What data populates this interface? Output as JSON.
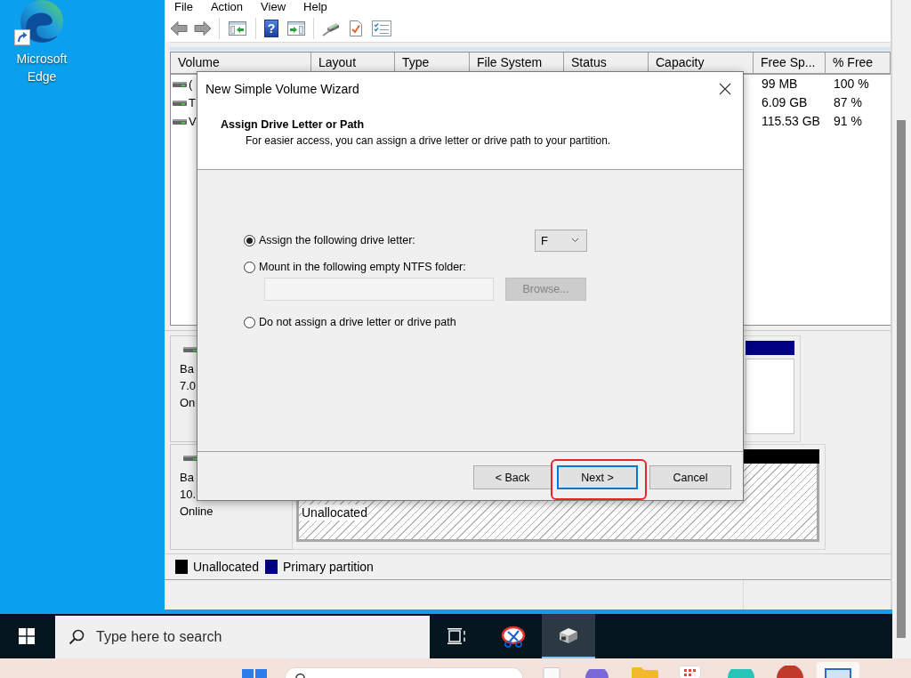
{
  "desktop": {
    "shortcuts": [
      {
        "label": "Microsoft Edge"
      }
    ]
  },
  "disk_management": {
    "menu": [
      "File",
      "Action",
      "View",
      "Help"
    ],
    "toolbar": {
      "help_glyph": "?"
    },
    "volume_list": {
      "columns": [
        "Volume",
        "Layout",
        "Type",
        "File System",
        "Status",
        "Capacity",
        "Free Sp...",
        "% Free"
      ],
      "rows": [
        {
          "volume": "(",
          "free_space": "99 MB",
          "percent_free": "100 %"
        },
        {
          "volume": "T",
          "free_space": "6.09 GB",
          "percent_free": "87 %"
        },
        {
          "volume": "V",
          "free_space": "115.53 GB",
          "percent_free": "91 %"
        }
      ]
    },
    "disks": [
      {
        "info": [
          "Ba",
          "7.0",
          "On"
        ],
        "partitions": [
          {
            "kind": "primary"
          }
        ]
      },
      {
        "info": [
          "Ba",
          "10.",
          "Online"
        ],
        "partitions": [
          {
            "kind": "unallocated",
            "label": "Unallocated"
          }
        ]
      }
    ],
    "legend": [
      {
        "label": "Unallocated",
        "color": "#000000"
      },
      {
        "label": "Primary partition",
        "color": "#000080"
      }
    ]
  },
  "wizard": {
    "title": "New Simple Volume Wizard",
    "heading": "Assign Drive Letter or Path",
    "description": "For easier access, you can assign a drive letter or drive path to your partition.",
    "options": [
      {
        "kind": "letter",
        "label": "Assign the following drive letter:",
        "selected": true,
        "drive_letter": {
          "value": "F"
        }
      },
      {
        "kind": "folder",
        "label": "Mount in the following empty NTFS folder:",
        "selected": false,
        "path_field": {
          "disabled": true
        },
        "browse_button": {
          "label": "Browse...",
          "disabled": true
        }
      },
      {
        "kind": "none",
        "label": "Do not assign a drive letter or drive path",
        "selected": false
      }
    ],
    "buttons": [
      {
        "label": "< Back",
        "focused": false,
        "highlighted": false
      },
      {
        "label": "Next >",
        "focused": true,
        "highlighted": true
      },
      {
        "label": "Cancel",
        "focused": false,
        "highlighted": false
      }
    ]
  },
  "taskbar": {
    "search": {
      "placeholder": "Type here to search"
    },
    "apps": [
      {
        "kind": "task_view",
        "selected": false
      },
      {
        "kind": "snipping",
        "selected": false
      },
      {
        "kind": "drives",
        "selected": true
      }
    ]
  },
  "lower_taskbar": {
    "apps": [
      {
        "kind": "document",
        "selected": false
      },
      {
        "kind": "sphere",
        "selected": false
      },
      {
        "kind": "folder",
        "selected": false
      },
      {
        "kind": "tile",
        "selected": false
      },
      {
        "kind": "ring",
        "selected": false
      },
      {
        "kind": "avatar",
        "selected": false
      },
      {
        "kind": "monitor",
        "selected": true
      }
    ]
  }
}
